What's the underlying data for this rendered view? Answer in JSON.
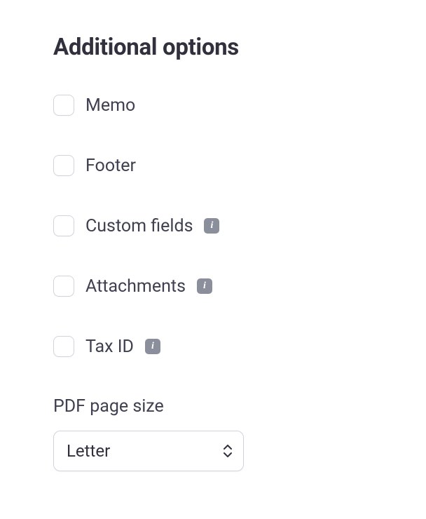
{
  "title": "Additional options",
  "options": [
    {
      "id": "memo",
      "label": "Memo",
      "checked": false,
      "info": false
    },
    {
      "id": "footer",
      "label": "Footer",
      "checked": false,
      "info": false
    },
    {
      "id": "custom-fields",
      "label": "Custom fields",
      "checked": false,
      "info": true
    },
    {
      "id": "attachments",
      "label": "Attachments",
      "checked": false,
      "info": true
    },
    {
      "id": "tax-id",
      "label": "Tax ID",
      "checked": false,
      "info": true
    }
  ],
  "pdfPageSize": {
    "label": "PDF page size",
    "selected": "Letter",
    "options": [
      "Letter"
    ]
  }
}
